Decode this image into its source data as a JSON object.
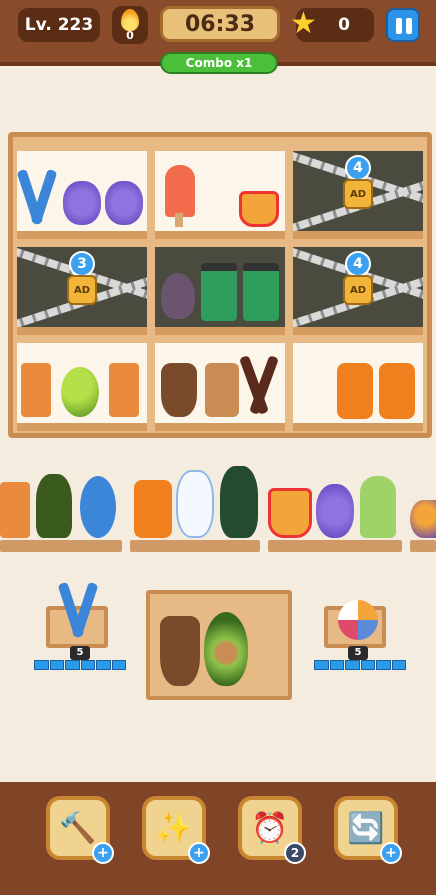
{
  "hud": {
    "level": "Lv. 223",
    "fire_count": "0",
    "timer": "06:33",
    "stars": "0",
    "combo": "Combo x1"
  },
  "locks": [
    {
      "count": "4",
      "tag": "AD"
    },
    {
      "count": "3",
      "tag": "AD"
    },
    {
      "count": "4",
      "tag": "AD"
    }
  ],
  "side_piles": {
    "left_count": "5",
    "right_count": "5"
  },
  "tools": [
    {
      "name": "hammer",
      "badge": "+"
    },
    {
      "name": "magic-wand",
      "badge": "+"
    },
    {
      "name": "alarm-clock",
      "badge": "2"
    },
    {
      "name": "shuffle",
      "badge": "+"
    }
  ],
  "colors": {
    "top_bar": "#8a4b2a",
    "wood": "#c98c52",
    "accent_blue": "#2b93e8",
    "combo_green": "#4cbf3a"
  }
}
